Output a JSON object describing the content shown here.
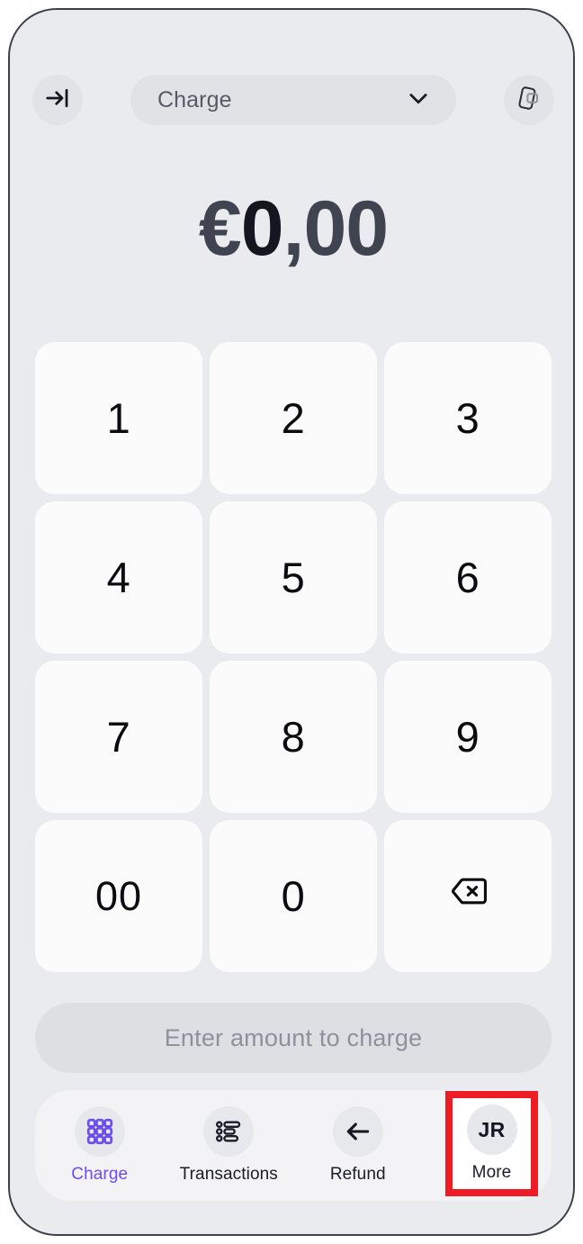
{
  "app": {
    "screen_name": "Charge keypad",
    "accent_color": "#6c4ef0",
    "highlight_color": "#ee1c25",
    "screen_background": "#eaebee",
    "key_background": "#fbfbfb"
  },
  "top_bar": {
    "exit_icon": "arrow-right-to-bar-icon",
    "mode_selector": {
      "label": "Charge",
      "chevron_icon": "chevron-down-icon"
    },
    "tap_to_pay_icon": "tap-to-pay-phone-card-icon"
  },
  "amount_display": {
    "currency_symbol": "€",
    "integer_part": "0",
    "decimal_separator": ",",
    "decimal_part": "00",
    "full_text": "€0,00"
  },
  "keypad": {
    "keys": [
      {
        "label": "1",
        "name": "key-1",
        "icon": null
      },
      {
        "label": "2",
        "name": "key-2",
        "icon": null
      },
      {
        "label": "3",
        "name": "key-3",
        "icon": null
      },
      {
        "label": "4",
        "name": "key-4",
        "icon": null
      },
      {
        "label": "5",
        "name": "key-5",
        "icon": null
      },
      {
        "label": "6",
        "name": "key-6",
        "icon": null
      },
      {
        "label": "7",
        "name": "key-7",
        "icon": null
      },
      {
        "label": "8",
        "name": "key-8",
        "icon": null
      },
      {
        "label": "9",
        "name": "key-9",
        "icon": null
      },
      {
        "label": "00",
        "name": "key-double-zero",
        "icon": null
      },
      {
        "label": "0",
        "name": "key-0",
        "icon": null
      },
      {
        "label": "",
        "name": "key-backspace",
        "icon": "backspace-icon"
      }
    ]
  },
  "submit": {
    "label": "Enter amount to charge",
    "enabled": false
  },
  "bottom_nav": {
    "items": [
      {
        "label": "Charge",
        "icon": "grid-3x3-icon",
        "active": true
      },
      {
        "label": "Transactions",
        "icon": "list-bars-icon",
        "active": false
      },
      {
        "label": "Refund",
        "icon": "arrow-left-icon",
        "active": false
      },
      {
        "label": "More",
        "icon": "avatar-initials",
        "avatar_initials": "JR",
        "active": false,
        "highlighted": true
      }
    ]
  }
}
